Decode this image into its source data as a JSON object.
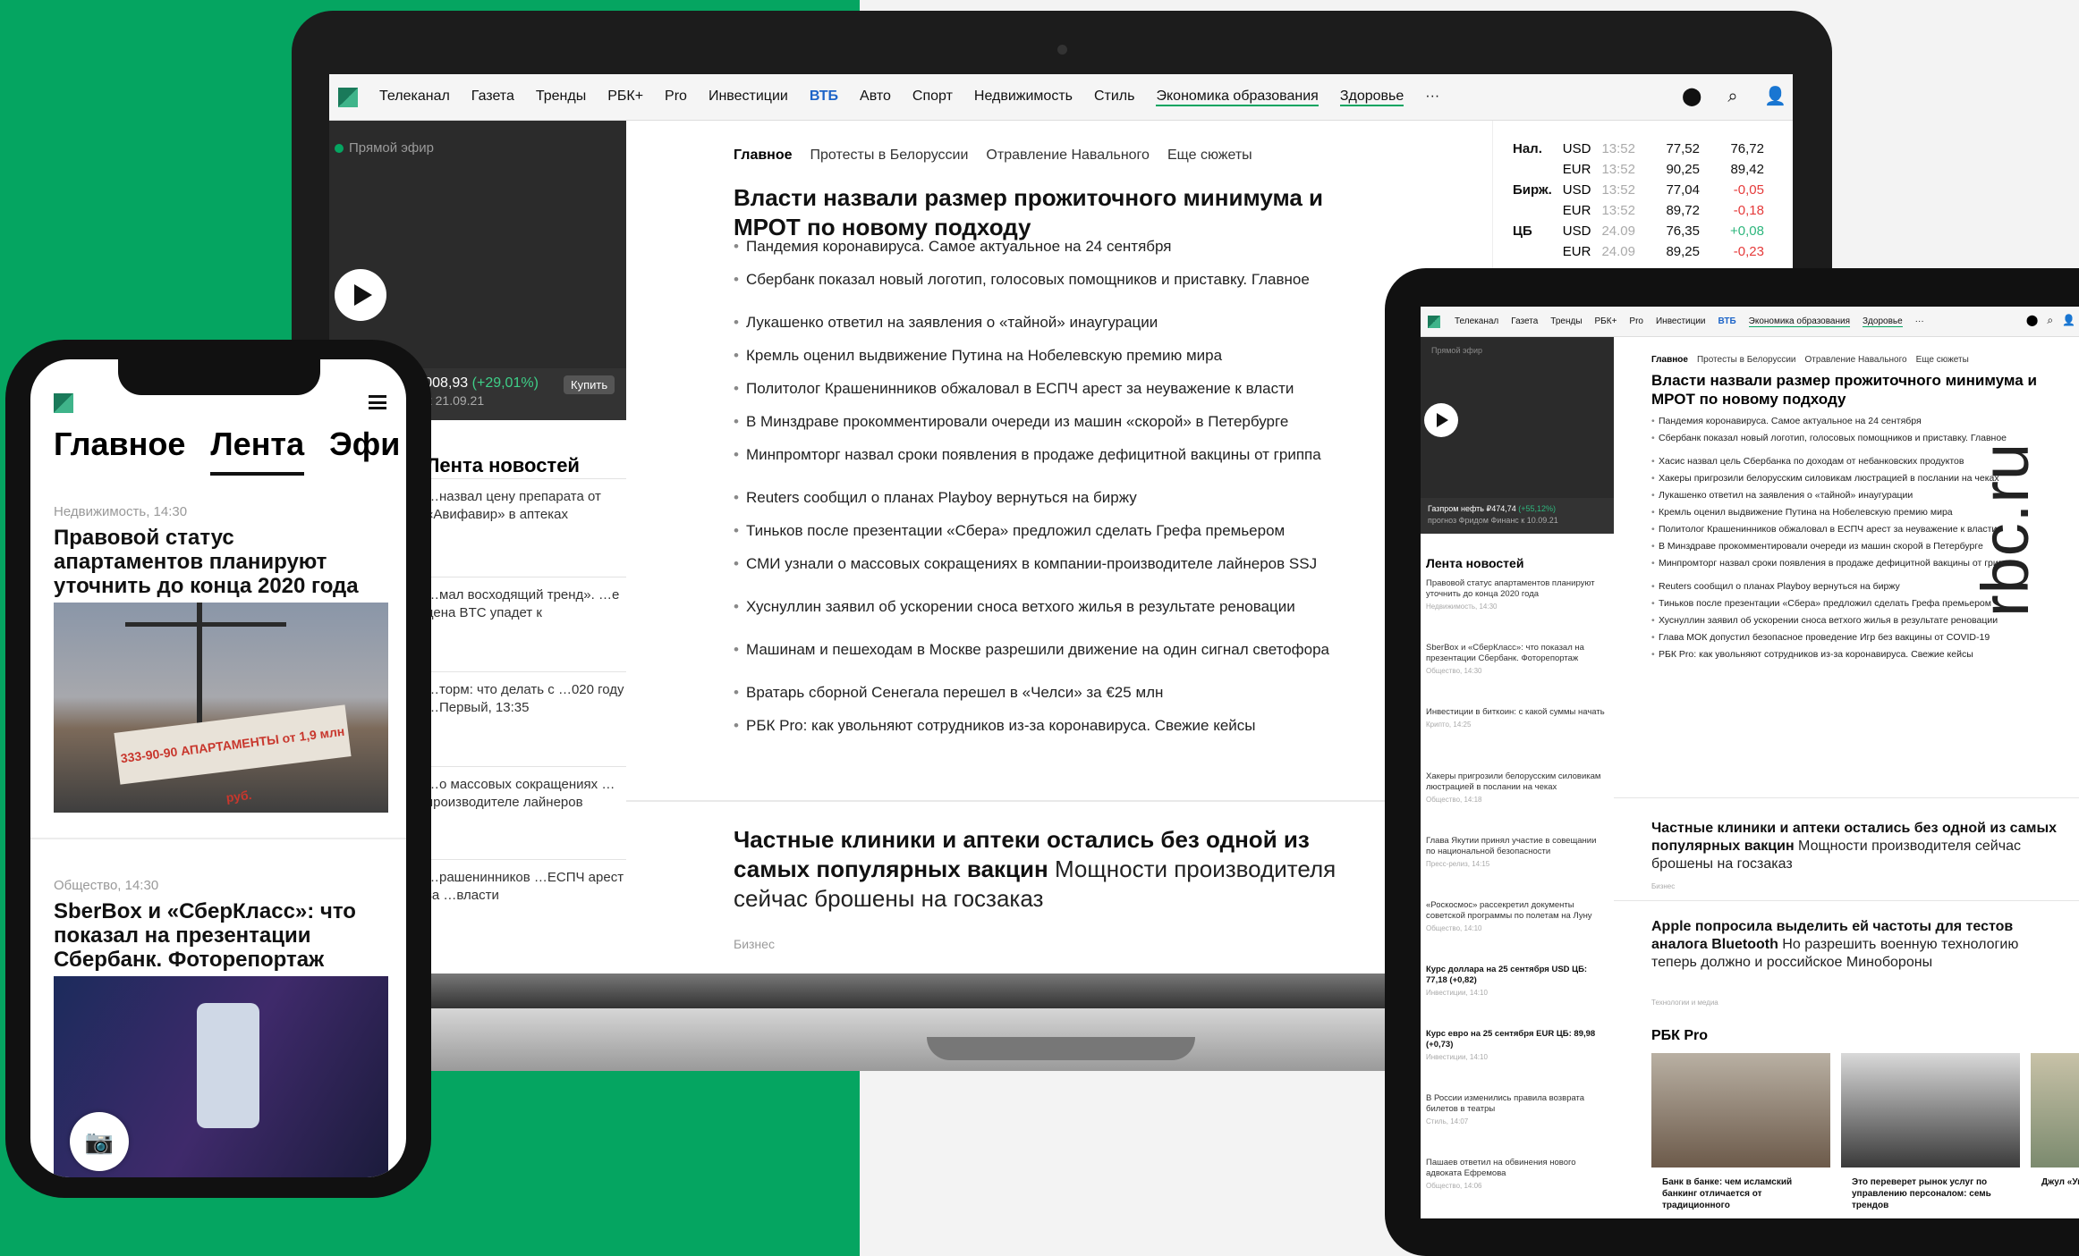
{
  "brand": "rbc.ru",
  "laptop": {
    "nav": [
      {
        "label": "Телеканал"
      },
      {
        "label": "Газета"
      },
      {
        "label": "Тренды"
      },
      {
        "label": "РБК+"
      },
      {
        "label": "Pro"
      },
      {
        "label": "Инвестиции"
      },
      {
        "label": "ВТБ"
      },
      {
        "label": "Авто"
      },
      {
        "label": "Спорт"
      },
      {
        "label": "Недвижимость"
      },
      {
        "label": "Стиль"
      },
      {
        "label": "Экономика образования"
      },
      {
        "label": "Здоровье"
      },
      {
        "label": "···"
      }
    ],
    "live_label": "Прямой эфир",
    "ticker": {
      "name": "Полюс ₽21 008,93",
      "change": "(+29,01%)",
      "sub": "прогноз Атон к 21.09.21",
      "buy": "Купить"
    },
    "lenta": {
      "title": "Лента новостей",
      "items": [
        "…назвал цену препарата от «Авифавир» в аптеках",
        "…мал восходящий тренд». …е цена BTC упадет к",
        "…торм: что делать с …020 году …Первый, 13:35",
        "…о массовых сокращениях …производителе лайнеров",
        "…рашенинников …ЕСПЧ арест за …власти"
      ]
    },
    "tabs": [
      "Главное",
      "Протесты в Белоруссии",
      "Отравление Навального",
      "Еще сюжеты"
    ],
    "headline": "Власти назвали размер прожиточного минимума и МРОТ по новому подходу",
    "bullets": [
      "Пандемия коронавируса. Самое актуальное на 24 сентября",
      "Сбербанк показал новый логотип, голосовых помощников и приставку. Главное",
      "Лукашенко ответил на заявления о «тайной» инаугурации",
      "Кремль оценил выдвижение Путина на Нобелевскую премию мира",
      "Политолог Крашенинников обжаловал в ЕСПЧ арест за неуважение к власти",
      "В Минздраве прокомментировали очереди из машин «скорой» в Петербурге",
      "Минпромторг назвал сроки появления в продаже дефицитной вакцины от гриппа",
      "Reuters сообщил о планах Playboy вернуться на биржу",
      "Тиньков после презентации «Сбера» предложил сделать Грефа премьером",
      "СМИ узнали о массовых сокращениях в компании-производителе лайнеров SSJ",
      "Хуснуллин заявил об ускорении сноса ветхого жилья в результате реновации",
      "Машинам и пешеходам в Москве разрешили движение на один сигнал светофора",
      "Вратарь сборной Сенегала перешел в «Челси» за €25 млн",
      "РБК Pro: как увольняют сотрудников из-за коронавируса. Свежие кейсы"
    ],
    "feature": {
      "bold": "Частные клиники и аптеки остались без одной из самых популярных вакцин",
      "rest": " Мощности производителя сейчас брошены на госзаказ",
      "tag": "Бизнес"
    },
    "rates": [
      {
        "label": "Нал.",
        "cur": "USD",
        "time": "13:52",
        "a": "77,52",
        "b": "76,72",
        "b_color": "#111111"
      },
      {
        "label": "",
        "cur": "EUR",
        "time": "13:52",
        "a": "90,25",
        "b": "89,42",
        "b_color": "#111111"
      },
      {
        "label": "Бирж.",
        "cur": "USD",
        "time": "13:52",
        "a": "77,04",
        "b": "-0,05",
        "b_color": "#e53b3b"
      },
      {
        "label": "",
        "cur": "EUR",
        "time": "13:52",
        "a": "89,72",
        "b": "-0,18",
        "b_color": "#e53b3b"
      },
      {
        "label": "ЦБ",
        "cur": "USD",
        "time": "24.09",
        "a": "76,35",
        "b": "+0,08",
        "b_color": "#2eb67d"
      },
      {
        "label": "",
        "cur": "EUR",
        "time": "24.09",
        "a": "89,25",
        "b": "-0,23",
        "b_color": "#e53b3b"
      }
    ]
  },
  "phone": {
    "tabs": [
      "Главное",
      "Лента",
      "Эфи"
    ],
    "items": [
      {
        "cat": "Недвижимость, 14:30",
        "title": "Правовой статус апартаментов планируют уточнить до конца 2020 года"
      },
      {
        "cat": "Общество, 14:30",
        "title": "SberBox и «СберКласс»: что показал на презентации Сбербанк. Фоторепортаж"
      }
    ],
    "banner_text": "333-90-90 АПАРТАМЕНТЫ от 1,9 млн руб."
  },
  "tablet": {
    "nav": [
      "Телеканал",
      "Газета",
      "Тренды",
      "РБК+",
      "Pro",
      "Инвестиции",
      "ВТБ",
      "Экономика образования",
      "Здоровье",
      "···"
    ],
    "live_label": "Прямой эфир",
    "ticker": {
      "a": "Газпром нефть ₽474,74",
      "change": "(+55,12%)",
      "b": "прогноз Фридом Финанс к 10.09.21"
    },
    "lenta_title": "Лента новостей",
    "lenta": [
      {
        "text": "Правовой статус апартаментов планируют уточнить до конца 2020 года",
        "meta": "Недвижимость, 14:30"
      },
      {
        "text": "SberBox и «СберКласс»: что показал на презентации Сбербанк. Фоторепортаж",
        "meta": "Общество, 14:30"
      },
      {
        "text": "Инвестиции в биткоин: с какой суммы начать",
        "meta": "Крипто, 14:25"
      },
      {
        "text": "Хакеры пригрозили белорусским силовикам люстрацией в послании на чеках",
        "meta": "Общество, 14:18"
      },
      {
        "text": "Глава Якутии принял участие в совещании по национальной безопасности",
        "meta": "Пресс-релиз, 14:15"
      },
      {
        "text": "«Роскосмос» рассекретил документы советской программы по полетам на Луну",
        "meta": "Общество, 14:10"
      },
      {
        "text": "Курс доллара на 25 сентября USD ЦБ: 77,18 (+0,82)",
        "meta": "Инвестиции, 14:10"
      },
      {
        "text": "Курс евро на 25 сентября EUR ЦБ: 89,98 (+0,73)",
        "meta": "Инвестиции, 14:10"
      },
      {
        "text": "В России изменились правила возврата билетов в театры",
        "meta": "Стиль, 14:07"
      },
      {
        "text": "Пашаев ответил на обвинения нового адвоката Ефремова",
        "meta": "Общество, 14:06"
      }
    ],
    "tabs": [
      "Главное",
      "Протесты в Белоруссии",
      "Отравление Навального",
      "Еще сюжеты"
    ],
    "headline": "Власти назвали размер прожиточного минимума и МРОТ по новому подходу",
    "bullets": [
      "Пандемия коронавируса. Самое актуальное на 24 сентября",
      "Сбербанк показал новый логотип, голосовых помощников и приставку. Главное",
      "Хасис назвал цель Сбербанка по доходам от небанковских продуктов",
      "Хакеры пригрозили белорусским силовикам люстрацией в послании на чеках",
      "Лукашенко ответил на заявления о «тайной» инаугурации",
      "Кремль оценил выдвижение Путина на Нобелевскую премию мира",
      "Политолог Крашенинников обжаловал в ЕСПЧ арест за неуважение к власти",
      "В Минздраве прокомментировали очереди из машин скорой в Петербурге",
      "Минпромторг назвал сроки появления в продаже дефицитной вакцины от гриппа",
      "Reuters сообщил о планах Playboy вернуться на биржу",
      "Тиньков после презентации «Сбера» предложил сделать Грефа премьером",
      "Хуснуллин заявил об ускорении сноса ветхого жилья в результате реновации",
      "Глава МОК допустил безопасное проведение Игр без вакцины от COVID-19",
      "РБК Pro: как увольняют сотрудников из-за коронавируса. Свежие кейсы"
    ],
    "feature1": {
      "bold": "Частные клиники и аптеки остались без одной из самых популярных вакцин",
      "rest": " Мощности производителя сейчас брошены на госзаказ",
      "tag": "Бизнес"
    },
    "feature2": {
      "bold": "Apple попросила выделить ей частоты для тестов аналога Bluetooth",
      "rest": " Но разрешить военную технологию теперь должно и российское Минобороны",
      "tag": "Технологии и медиа"
    },
    "pro_title": "РБК Pro",
    "cards": [
      {
        "caption": "Банк в банке: чем исламский банкинг отличается от традиционного"
      },
      {
        "caption": "Это переверет рынок услуг по управлению персоналом: семь трендов"
      },
      {
        "caption": "Джул «Увол интри"
      }
    ]
  }
}
